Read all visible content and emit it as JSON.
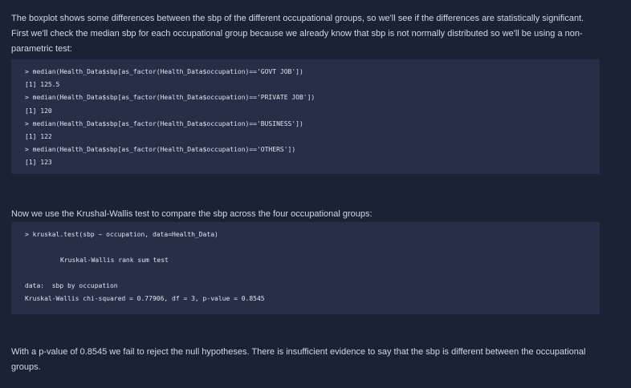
{
  "paragraphs": {
    "intro": "The boxplot shows some differences between the sbp of the different occupational groups, so we'll see if the differences are statistically significant. First we'll check the median sbp for each occupational group because we already know that sbp is not normally distributed so we'll be using a non-parametric test:",
    "kruskal_intro": "Now we use the Krushal-Wallis test to compare the sbp across the four occupational groups:",
    "conclusion": "With a p-value of 0.8545 we fail to reject the null hypotheses. There is insufficient evidence to say that the sbp is different between the occupational groups."
  },
  "code_block_1": {
    "lines": [
      "> median(Health_Data$sbp[as_factor(Health_Data$occupation)=='GOVT JOB'])",
      "[1] 125.5",
      "> median(Health_Data$sbp[as_factor(Health_Data$occupation)=='PRIVATE JOB'])",
      "[1] 120",
      "> median(Health_Data$sbp[as_factor(Health_Data$occupation)=='BUSINESS'])",
      "[1] 122",
      "> median(Health_Data$sbp[as_factor(Health_Data$occupation)=='OTHERS'])",
      "[1] 123"
    ]
  },
  "code_block_2": {
    "command": "> kruskal.test(sbp ~ occupation, data=Health_Data)",
    "test_title": "Kruskal-Wallis rank sum test",
    "data_line": "data:  sbp by occupation",
    "result_line": "Kruskal-Wallis chi-squared = 0.77906, df = 3, p-value = 0.8545"
  }
}
